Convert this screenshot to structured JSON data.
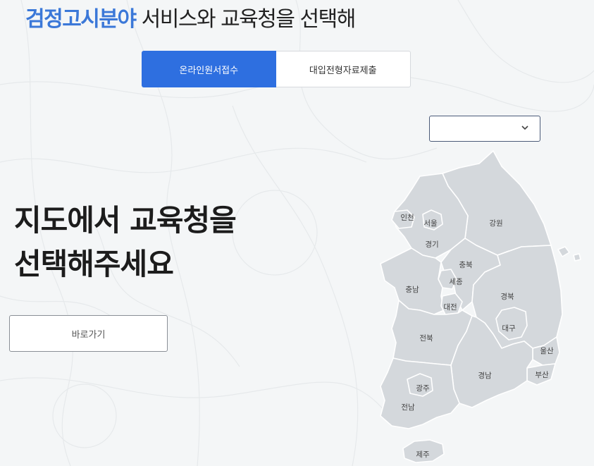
{
  "header": {
    "accent_text": "검정고시분야",
    "rest_text": " 서비스와 교육청을 선택해"
  },
  "tabs": [
    {
      "label": "온라인원서접수",
      "active": true
    },
    {
      "label": "대입전형자료제출",
      "active": false
    }
  ],
  "region_select": {
    "value": "",
    "icon": "chevron-down-icon"
  },
  "main": {
    "title_line1": "지도에서 교육청을",
    "title_line2": "선택해주세요",
    "go_button_label": "바로가기"
  },
  "map": {
    "regions": {
      "incheon": "인천",
      "seoul": "서울",
      "gyeonggi": "경기",
      "gangwon": "강원",
      "chungbuk": "충북",
      "sejong": "세종",
      "chungnam": "충남",
      "daejeon": "대전",
      "gyeongbuk": "경북",
      "daegu": "대구",
      "jeonbuk": "전북",
      "ulsan": "울산",
      "busan": "부산",
      "gyeongnam": "경남",
      "gwangju": "광주",
      "jeonnam": "전남",
      "jeju": "제주"
    }
  },
  "colors": {
    "accent": "#3b78d8",
    "tab_active_bg": "#2e6fe0",
    "map_fill": "#d4d8dc",
    "background": "#f4f6f7"
  }
}
